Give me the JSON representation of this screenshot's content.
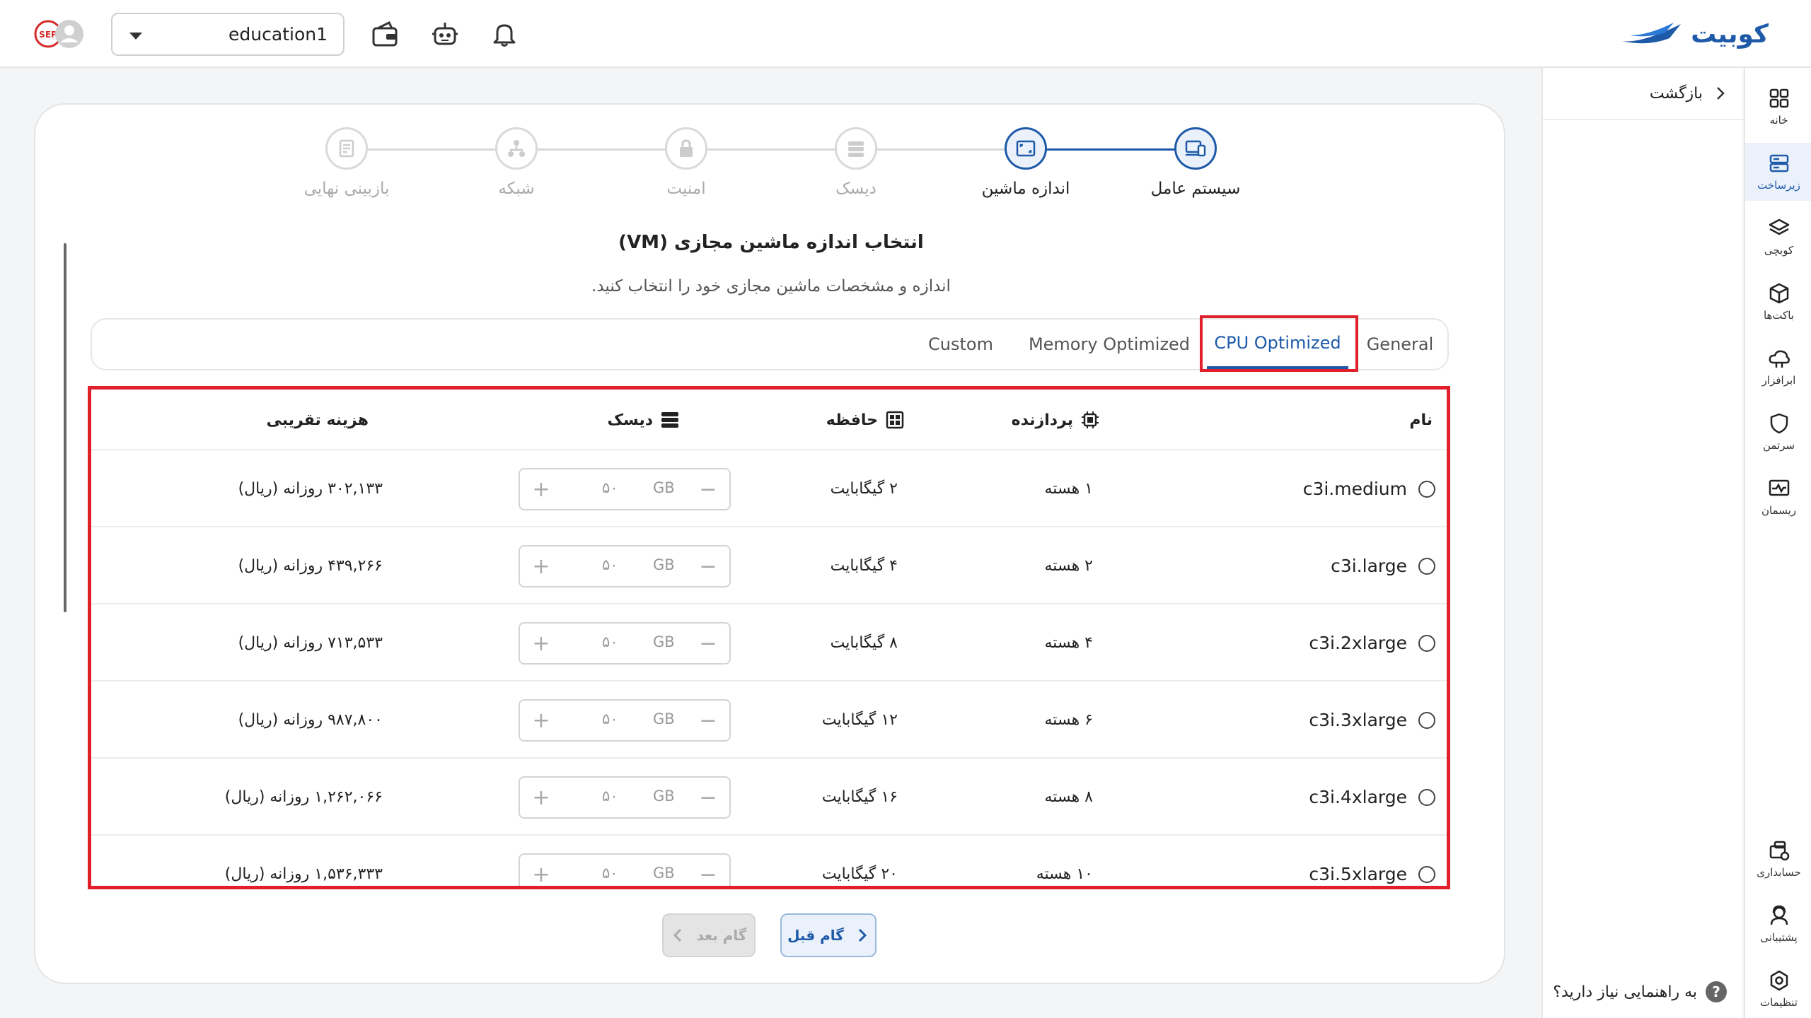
{
  "brand": {
    "name": "کوبیت",
    "color": "#1e5aa8"
  },
  "topbar": {
    "project_value": "education1",
    "icons": [
      "wallet-icon",
      "robot-icon",
      "bell-icon"
    ]
  },
  "sidebar": {
    "items": [
      {
        "label": "خانه",
        "icon": "grid-icon"
      },
      {
        "label": "زیرساخت",
        "icon": "server-icon",
        "active": true
      },
      {
        "label": "کوبچی",
        "icon": "layers-icon"
      },
      {
        "label": "باکت‌ها",
        "icon": "cube-icon"
      },
      {
        "label": "ابرافزار",
        "icon": "cloud-icon"
      },
      {
        "label": "سرتمن",
        "icon": "shield-icon"
      },
      {
        "label": "ریسمان",
        "icon": "monitor-icon"
      }
    ],
    "bottom_items": [
      {
        "label": "حسابداری",
        "icon": "accounting-icon"
      },
      {
        "label": "پشتیبانی",
        "icon": "support-icon"
      },
      {
        "label": "تنظیمات",
        "icon": "settings-icon"
      }
    ]
  },
  "back_panel": {
    "back_label": "بازگشت",
    "help_label": "به راهنمایی نیاز دارید؟",
    "help_mark": "?"
  },
  "stepper": {
    "steps": [
      {
        "label": "سیستم عامل",
        "state": "active"
      },
      {
        "label": "اندازه ماشین",
        "state": "active"
      },
      {
        "label": "دیسک",
        "state": "pending"
      },
      {
        "label": "امنیت",
        "state": "pending"
      },
      {
        "label": "شبکه",
        "state": "pending"
      },
      {
        "label": "بازبینی نهایی",
        "state": "pending"
      }
    ]
  },
  "main": {
    "title": "انتخاب اندازه ماشین مجازی (VM)",
    "subtitle": "اندازه و مشخصات ماشین مجازی خود را انتخاب کنید."
  },
  "tabs": [
    {
      "label": "General"
    },
    {
      "label": "CPU Optimized",
      "selected": true
    },
    {
      "label": "Memory Optimized"
    },
    {
      "label": "Custom"
    }
  ],
  "table": {
    "headers": {
      "name": "نام",
      "cpu": "پردازنده",
      "memory": "حافظه",
      "disk": "دیسک",
      "cost": "هزینه تقریبی"
    },
    "disk_unit": "GB",
    "rows": [
      {
        "name": "c3i.medium",
        "cpu": "۱ هسته",
        "memory": "۲ گیگابایت",
        "disk": "۵۰",
        "cost": "۳۰۲,۱۳۳ روزانه (ریال)"
      },
      {
        "name": "c3i.large",
        "cpu": "۲ هسته",
        "memory": "۴ گیگابایت",
        "disk": "۵۰",
        "cost": "۴۳۹,۲۶۶ روزانه (ریال)"
      },
      {
        "name": "c3i.2xlarge",
        "cpu": "۴ هسته",
        "memory": "۸ گیگابایت",
        "disk": "۵۰",
        "cost": "۷۱۳,۵۳۳ روزانه (ریال)"
      },
      {
        "name": "c3i.3xlarge",
        "cpu": "۶ هسته",
        "memory": "۱۲ گیگابایت",
        "disk": "۵۰",
        "cost": "۹۸۷,۸۰۰ روزانه (ریال)"
      },
      {
        "name": "c3i.4xlarge",
        "cpu": "۸ هسته",
        "memory": "۱۶ گیگابایت",
        "disk": "۵۰",
        "cost": "۱,۲۶۲,۰۶۶ روزانه (ریال)"
      },
      {
        "name": "c3i.5xlarge",
        "cpu": "۱۰ هسته",
        "memory": "۲۰ گیگابایت",
        "disk": "۵۰",
        "cost": "۱,۵۳۶,۳۳۳ روزانه (ریال)"
      }
    ]
  },
  "buttons": {
    "prev_label": "گام قبل",
    "next_label": "گام بعد"
  },
  "highlight_color": "#e0202a"
}
